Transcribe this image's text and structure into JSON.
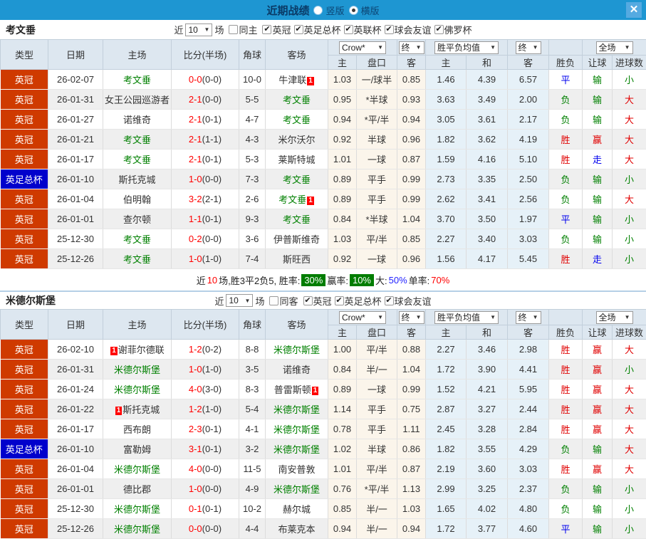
{
  "titlebar": {
    "title": "近期战绩",
    "vertical_label": "竖版",
    "horizontal_label": "横版",
    "close_label": "✕"
  },
  "header": {
    "cols": [
      "类型",
      "日期",
      "主场",
      "比分(半场)",
      "角球",
      "客场"
    ],
    "dd": {
      "crow": "Crow*",
      "final1": "终",
      "avg": "胜平负均值",
      "final2": "终",
      "full": "全场"
    },
    "sub": [
      "主",
      "盘口",
      "客",
      "主",
      "和",
      "客",
      "胜负",
      "让球",
      "进球数"
    ]
  },
  "sections": [
    {
      "team": "考文垂",
      "filter": {
        "near_label": "近",
        "count": "10",
        "unit_label": "场",
        "same": {
          "label": "同主",
          "checked": false
        },
        "leagues": [
          {
            "label": "英冠",
            "checked": true
          },
          {
            "label": "英足总杯",
            "checked": true
          },
          {
            "label": "英联杯",
            "checked": true
          },
          {
            "label": "球会友谊",
            "checked": true
          },
          {
            "label": "佛罗杯",
            "checked": true
          }
        ]
      },
      "rows": [
        {
          "type": "英冠",
          "date": "26-02-07",
          "home": "考文垂",
          "home_hl": true,
          "score": "0-0",
          "half": "(0-0)",
          "corner": "10-0",
          "away": "牛津联",
          "away_hl": false,
          "away_badge": "1",
          "away_badge_pos": "after",
          "o1": "1.03",
          "handicap": "一/球半",
          "o2": "0.85",
          "w": "1.46",
          "d": "4.39",
          "l": "6.57",
          "res": "平",
          "give": "输",
          "goals": "小"
        },
        {
          "type": "英冠",
          "date": "26-01-31",
          "home": "女王公园巡游者",
          "home_hl": false,
          "score": "2-1",
          "half": "(0-0)",
          "corner": "5-5",
          "away": "考文垂",
          "away_hl": true,
          "o1": "0.95",
          "handicap": "*半球",
          "o2": "0.93",
          "w": "3.63",
          "d": "3.49",
          "l": "2.00",
          "res": "负",
          "give": "输",
          "goals": "大"
        },
        {
          "type": "英冠",
          "date": "26-01-27",
          "home": "诺维奇",
          "home_hl": false,
          "score": "2-1",
          "half": "(0-1)",
          "corner": "4-7",
          "away": "考文垂",
          "away_hl": true,
          "o1": "0.94",
          "handicap": "*平/半",
          "o2": "0.94",
          "w": "3.05",
          "d": "3.61",
          "l": "2.17",
          "res": "负",
          "give": "输",
          "goals": "大"
        },
        {
          "type": "英冠",
          "date": "26-01-21",
          "home": "考文垂",
          "home_hl": true,
          "score": "2-1",
          "half": "(1-1)",
          "corner": "4-3",
          "away": "米尔沃尔",
          "away_hl": false,
          "o1": "0.92",
          "handicap": "半球",
          "o2": "0.96",
          "w": "1.82",
          "d": "3.62",
          "l": "4.19",
          "res": "胜",
          "give": "赢",
          "goals": "大"
        },
        {
          "type": "英冠",
          "date": "26-01-17",
          "home": "考文垂",
          "home_hl": true,
          "score": "2-1",
          "half": "(0-1)",
          "corner": "5-3",
          "away": "莱斯特城",
          "away_hl": false,
          "o1": "1.01",
          "handicap": "一球",
          "o2": "0.87",
          "w": "1.59",
          "d": "4.16",
          "l": "5.10",
          "res": "胜",
          "give": "走",
          "goals": "大"
        },
        {
          "type": "英足总杯",
          "date": "26-01-10",
          "home": "斯托克城",
          "home_hl": false,
          "score": "1-0",
          "half": "(0-0)",
          "corner": "7-3",
          "away": "考文垂",
          "away_hl": true,
          "o1": "0.89",
          "handicap": "平手",
          "o2": "0.99",
          "w": "2.73",
          "d": "3.35",
          "l": "2.50",
          "res": "负",
          "give": "输",
          "goals": "小"
        },
        {
          "type": "英冠",
          "date": "26-01-04",
          "home": "伯明翰",
          "home_hl": false,
          "score": "3-2",
          "half": "(2-1)",
          "corner": "2-6",
          "away": "考文垂",
          "away_hl": true,
          "away_badge": "1",
          "away_badge_pos": "after",
          "o1": "0.89",
          "handicap": "平手",
          "o2": "0.99",
          "w": "2.62",
          "d": "3.41",
          "l": "2.56",
          "res": "负",
          "give": "输",
          "goals": "大"
        },
        {
          "type": "英冠",
          "date": "26-01-01",
          "home": "查尔顿",
          "home_hl": false,
          "score": "1-1",
          "half": "(0-1)",
          "corner": "9-3",
          "away": "考文垂",
          "away_hl": true,
          "o1": "0.84",
          "handicap": "*半球",
          "o2": "1.04",
          "w": "3.70",
          "d": "3.50",
          "l": "1.97",
          "res": "平",
          "give": "输",
          "goals": "小"
        },
        {
          "type": "英冠",
          "date": "25-12-30",
          "home": "考文垂",
          "home_hl": true,
          "score": "0-2",
          "half": "(0-0)",
          "corner": "3-6",
          "away": "伊普斯维奇",
          "away_hl": false,
          "o1": "1.03",
          "handicap": "平/半",
          "o2": "0.85",
          "w": "2.27",
          "d": "3.40",
          "l": "3.03",
          "res": "负",
          "give": "输",
          "goals": "小"
        },
        {
          "type": "英冠",
          "date": "25-12-26",
          "home": "考文垂",
          "home_hl": true,
          "score": "1-0",
          "half": "(1-0)",
          "corner": "7-4",
          "away": "斯旺西",
          "away_hl": false,
          "o1": "0.92",
          "handicap": "一球",
          "o2": "0.96",
          "w": "1.56",
          "d": "4.17",
          "l": "5.45",
          "res": "胜",
          "give": "走",
          "goals": "小"
        }
      ],
      "summary": [
        {
          "text": "近",
          "style": ""
        },
        {
          "text": "10",
          "style": "red"
        },
        {
          "text": "场,胜3平2负5, 胜率:",
          "style": ""
        },
        {
          "text": "30%",
          "style": "greenbox"
        },
        {
          "text": "赢率:",
          "style": ""
        },
        {
          "text": "10%",
          "style": "greenbox"
        },
        {
          "text": "大:",
          "style": ""
        },
        {
          "text": "50%",
          "style": "blue"
        },
        {
          "text": "单率:",
          "style": ""
        },
        {
          "text": "70%",
          "style": "red"
        }
      ]
    },
    {
      "team": "米德尔斯堡",
      "filter": {
        "near_label": "近",
        "count": "10",
        "unit_label": "场",
        "same": {
          "label": "同客",
          "checked": false
        },
        "leagues": [
          {
            "label": "英冠",
            "checked": true
          },
          {
            "label": "英足总杯",
            "checked": true
          },
          {
            "label": "球会友谊",
            "checked": true
          }
        ]
      },
      "rows": [
        {
          "type": "英冠",
          "date": "26-02-10",
          "home": "谢菲尔德联",
          "home_hl": false,
          "home_badge": "1",
          "home_badge_pos": "before",
          "score": "1-2",
          "half": "(0-2)",
          "corner": "8-8",
          "away": "米德尔斯堡",
          "away_hl": true,
          "o1": "1.00",
          "handicap": "平/半",
          "o2": "0.88",
          "w": "2.27",
          "d": "3.46",
          "l": "2.98",
          "res": "胜",
          "give": "赢",
          "goals": "大"
        },
        {
          "type": "英冠",
          "date": "26-01-31",
          "home": "米德尔斯堡",
          "home_hl": true,
          "score": "1-0",
          "half": "(1-0)",
          "corner": "3-5",
          "away": "诺维奇",
          "away_hl": false,
          "o1": "0.84",
          "handicap": "半/一",
          "o2": "1.04",
          "w": "1.72",
          "d": "3.90",
          "l": "4.41",
          "res": "胜",
          "give": "赢",
          "goals": "小"
        },
        {
          "type": "英冠",
          "date": "26-01-24",
          "home": "米德尔斯堡",
          "home_hl": true,
          "score": "4-0",
          "half": "(3-0)",
          "corner": "8-3",
          "away": "普雷斯顿",
          "away_hl": false,
          "away_badge": "1",
          "away_badge_pos": "after",
          "o1": "0.89",
          "handicap": "一球",
          "o2": "0.99",
          "w": "1.52",
          "d": "4.21",
          "l": "5.95",
          "res": "胜",
          "give": "赢",
          "goals": "大"
        },
        {
          "type": "英冠",
          "date": "26-01-22",
          "home": "斯托克城",
          "home_hl": false,
          "home_badge": "1",
          "home_badge_pos": "before",
          "score": "1-2",
          "half": "(1-0)",
          "corner": "5-4",
          "away": "米德尔斯堡",
          "away_hl": true,
          "o1": "1.14",
          "handicap": "平手",
          "o2": "0.75",
          "w": "2.87",
          "d": "3.27",
          "l": "2.44",
          "res": "胜",
          "give": "赢",
          "goals": "大"
        },
        {
          "type": "英冠",
          "date": "26-01-17",
          "home": "西布朗",
          "home_hl": false,
          "score": "2-3",
          "half": "(0-1)",
          "corner": "4-1",
          "away": "米德尔斯堡",
          "away_hl": true,
          "o1": "0.78",
          "handicap": "平手",
          "o2": "1.11",
          "w": "2.45",
          "d": "3.28",
          "l": "2.84",
          "res": "胜",
          "give": "赢",
          "goals": "大"
        },
        {
          "type": "英足总杯",
          "date": "26-01-10",
          "home": "富勒姆",
          "home_hl": false,
          "score": "3-1",
          "half": "(0-1)",
          "corner": "3-2",
          "away": "米德尔斯堡",
          "away_hl": true,
          "o1": "1.02",
          "handicap": "半球",
          "o2": "0.86",
          "w": "1.82",
          "d": "3.55",
          "l": "4.29",
          "res": "负",
          "give": "输",
          "goals": "大"
        },
        {
          "type": "英冠",
          "date": "26-01-04",
          "home": "米德尔斯堡",
          "home_hl": true,
          "score": "4-0",
          "half": "(0-0)",
          "corner": "11-5",
          "away": "南安普敦",
          "away_hl": false,
          "o1": "1.01",
          "handicap": "平/半",
          "o2": "0.87",
          "w": "2.19",
          "d": "3.60",
          "l": "3.03",
          "res": "胜",
          "give": "赢",
          "goals": "大"
        },
        {
          "type": "英冠",
          "date": "26-01-01",
          "home": "德比郡",
          "home_hl": false,
          "score": "1-0",
          "half": "(0-0)",
          "corner": "4-9",
          "away": "米德尔斯堡",
          "away_hl": true,
          "o1": "0.76",
          "handicap": "*平/半",
          "o2": "1.13",
          "w": "2.99",
          "d": "3.25",
          "l": "2.37",
          "res": "负",
          "give": "输",
          "goals": "小"
        },
        {
          "type": "英冠",
          "date": "25-12-30",
          "home": "米德尔斯堡",
          "home_hl": true,
          "score": "0-1",
          "half": "(0-1)",
          "corner": "10-2",
          "away": "赫尔城",
          "away_hl": false,
          "o1": "0.85",
          "handicap": "半/一",
          "o2": "1.03",
          "w": "1.65",
          "d": "4.02",
          "l": "4.80",
          "res": "负",
          "give": "输",
          "goals": "小"
        },
        {
          "type": "英冠",
          "date": "25-12-26",
          "home": "米德尔斯堡",
          "home_hl": true,
          "score": "0-0",
          "half": "(0-0)",
          "corner": "4-4",
          "away": "布莱克本",
          "away_hl": false,
          "o1": "0.94",
          "handicap": "半/一",
          "o2": "0.94",
          "w": "1.72",
          "d": "3.77",
          "l": "4.60",
          "res": "平",
          "give": "输",
          "goals": "小"
        }
      ],
      "summary": null
    }
  ]
}
